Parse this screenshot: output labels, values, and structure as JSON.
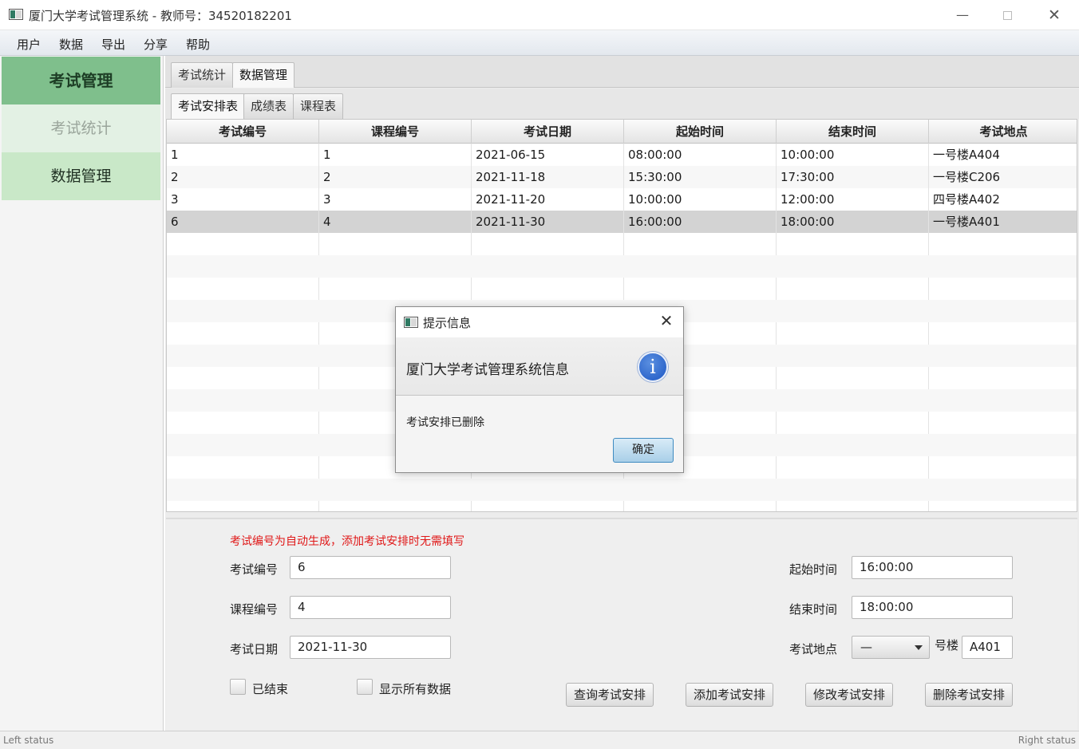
{
  "window": {
    "title": "厦门大学考试管理系统 - 教师号：34520182201",
    "min_label": "—",
    "close_label": "✕"
  },
  "menu": [
    "用户",
    "数据",
    "导出",
    "分享",
    "帮助"
  ],
  "sidebar": {
    "header": "考试管理",
    "items": [
      "考试统计",
      "数据管理"
    ]
  },
  "tabs_main": [
    "考试统计",
    "数据管理"
  ],
  "tabs_sub": [
    "考试安排表",
    "成绩表",
    "课程表"
  ],
  "table": {
    "columns": [
      "考试编号",
      "课程编号",
      "考试日期",
      "起始时间",
      "结束时间",
      "考试地点"
    ],
    "rows": [
      [
        "1",
        "1",
        "2021-06-15",
        "08:00:00",
        "10:00:00",
        "一号楼A404"
      ],
      [
        "2",
        "2",
        "2021-11-18",
        "15:30:00",
        "17:30:00",
        "一号楼C206"
      ],
      [
        "3",
        "3",
        "2021-11-20",
        "10:00:00",
        "12:00:00",
        "四号楼A402"
      ],
      [
        "6",
        "4",
        "2021-11-30",
        "16:00:00",
        "18:00:00",
        "一号楼A401"
      ]
    ],
    "selected_row": 3
  },
  "form": {
    "hint": "考试编号为自动生成，添加考试安排时无需填写",
    "exam_id_label": "考试编号",
    "exam_id_value": "6",
    "course_id_label": "课程编号",
    "course_id_value": "4",
    "exam_date_label": "考试日期",
    "exam_date_value": "2021-11-30",
    "start_time_label": "起始时间",
    "start_time_value": "16:00:00",
    "end_time_label": "结束时间",
    "end_time_value": "18:00:00",
    "location_label": "考试地点",
    "building_select": "—",
    "building_suffix": "号楼",
    "room_value": "A401",
    "finished_label": "已结束",
    "show_all_label": "显示所有数据",
    "buttons": {
      "query": "查询考试安排",
      "add": "添加考试安排",
      "modify": "修改考试安排",
      "delete": "删除考试安排"
    }
  },
  "status": {
    "left": "Left status",
    "right": "Right status"
  },
  "dialog": {
    "title": "提示信息",
    "header": "厦门大学考试管理系统信息",
    "message": "考试安排已删除",
    "ok_label": "确定",
    "close_label": "✕",
    "icon_glyph": "i"
  },
  "colors": {
    "sidebar_header": "#7fbf8c",
    "sidebar_active": "#c9e8c8",
    "hint_red": "#e01818",
    "info_blue": "#1d57c4"
  }
}
